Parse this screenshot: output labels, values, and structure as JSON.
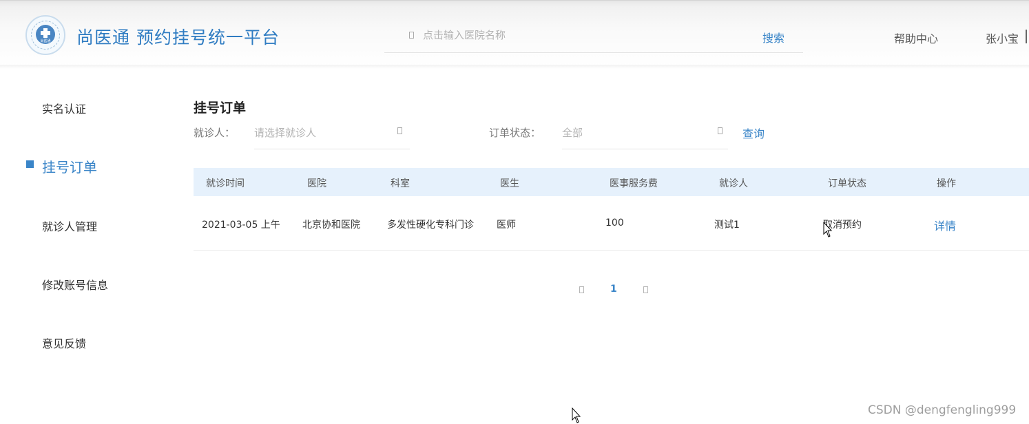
{
  "header": {
    "brand": "尚医通 预约挂号统一平台",
    "logo_text": "尚医通",
    "search": {
      "placeholder": "点击输入医院名称",
      "button": "搜索"
    },
    "help": "帮助中心",
    "user": "张小宝"
  },
  "sidebar": {
    "items": [
      {
        "label": "实名认证"
      },
      {
        "label": "挂号订单"
      },
      {
        "label": "就诊人管理"
      },
      {
        "label": "修改账号信息"
      },
      {
        "label": "意见反馈"
      }
    ],
    "active_index": 1
  },
  "main": {
    "title": "挂号订单",
    "filters": {
      "patient_label": "就诊人：",
      "patient_placeholder": "请选择就诊人",
      "status_label": "订单状态：",
      "status_value": "全部",
      "query_button": "查询"
    },
    "table": {
      "columns": [
        "就诊时间",
        "医院",
        "科室",
        "医生",
        "医事服务费",
        "就诊人",
        "订单状态",
        "操作"
      ],
      "rows": [
        [
          "2021-03-05 上午",
          "北京协和医院",
          "多发性硬化专科门诊",
          "医师",
          "100",
          "测试1",
          "取消预约",
          "详情"
        ]
      ]
    },
    "pagination": {
      "current": "1"
    }
  },
  "watermark": "CSDN @dengfengling999",
  "colors": {
    "accent": "#3a85c8",
    "table_header_bg": "#e6f1fc",
    "text": "#333333",
    "muted": "#777777"
  }
}
